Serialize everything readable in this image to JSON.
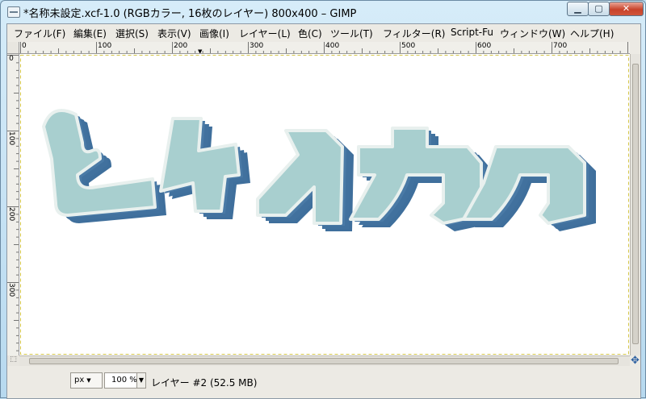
{
  "window": {
    "title": "*名称未設定.xcf-1.0 (RGBカラー, 16枚のレイヤー) 800x400 – GIMP",
    "minimize_icon": "minimize-icon",
    "maximize_icon": "maximize-icon",
    "close_icon": "close-icon"
  },
  "menubar": {
    "items": [
      "ファイル(F)",
      "編集(E)",
      "選択(S)",
      "表示(V)",
      "画像(I)",
      "レイヤー(L)",
      "色(C)",
      "ツール(T)",
      "フィルター(R)",
      "Script-Fu",
      "ウィンドウ(W)",
      "ヘルプ(H)"
    ]
  },
  "rulers": {
    "horizontal_labels": [
      "0",
      "100",
      "200",
      "300",
      "400",
      "500",
      "600",
      "700"
    ],
    "vertical_labels": [
      "0",
      "100",
      "200",
      "300"
    ]
  },
  "canvas": {
    "artwork_text": "ムケイカク",
    "face_color": "#a8cfcf",
    "outline_color": "#ffffff",
    "extrusion_color": "#3f6f9c",
    "background_color": "#ffffff"
  },
  "statusbar": {
    "unit": "px",
    "zoom": "100 %",
    "info": "レイヤー #2 (52.5 MB)"
  },
  "icons": {
    "quickmask": "quickmask-icon",
    "navigate": "navigate-icon"
  }
}
